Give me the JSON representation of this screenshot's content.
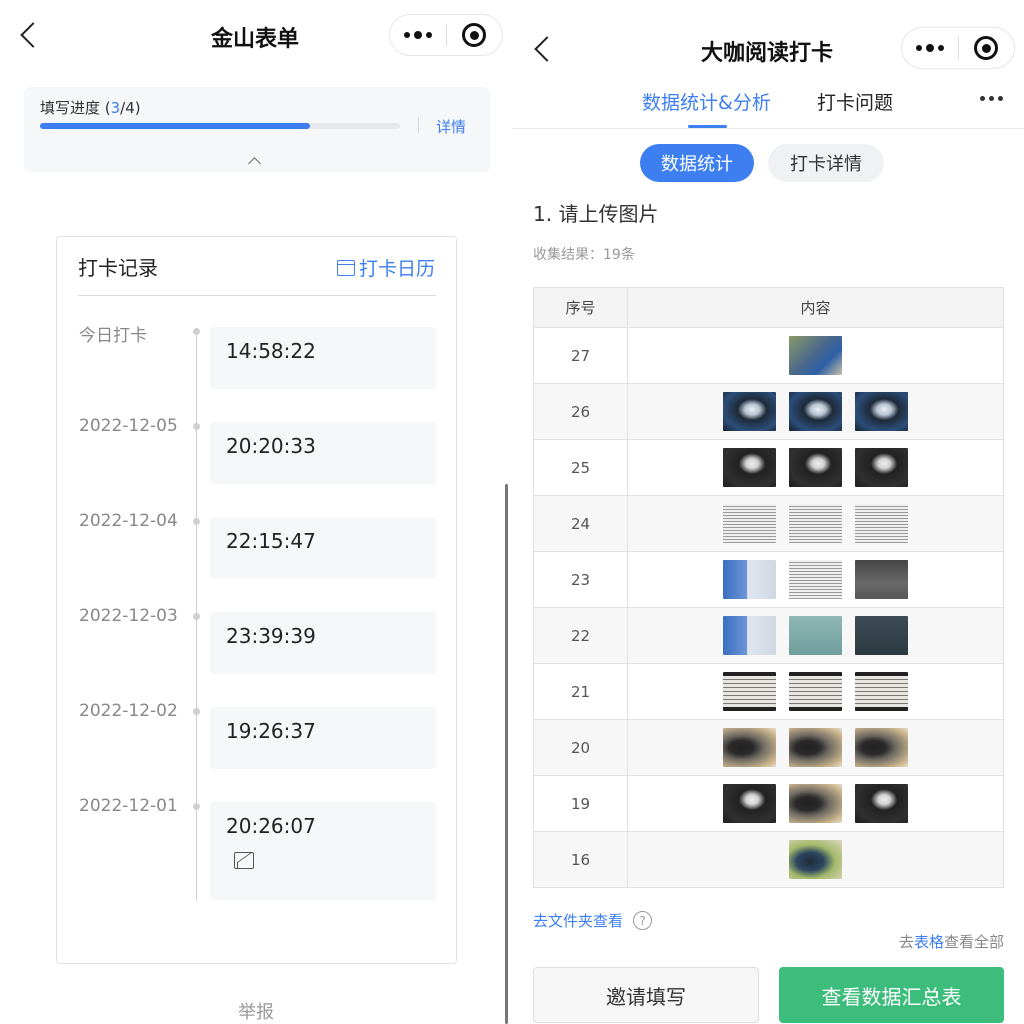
{
  "left": {
    "title": "金山表单",
    "progress": {
      "label_prefix": "填写进度 (",
      "current": "3",
      "label_suffix": "/4)",
      "fraction": 0.75,
      "detail_link": "详情"
    },
    "record": {
      "title": "打卡记录",
      "calendar_link": "打卡日历",
      "entries": [
        {
          "date": "今日打卡",
          "time": "14:58:22",
          "has_image": false
        },
        {
          "date": "2022-12-05",
          "time": "20:20:33",
          "has_image": false
        },
        {
          "date": "2022-12-04",
          "time": "22:15:47",
          "has_image": false
        },
        {
          "date": "2022-12-03",
          "time": "23:39:39",
          "has_image": false
        },
        {
          "date": "2022-12-02",
          "time": "19:26:37",
          "has_image": false
        },
        {
          "date": "2022-12-01",
          "time": "20:26:07",
          "has_image": true
        }
      ]
    },
    "report": "举报"
  },
  "right": {
    "title": "大咖阅读打卡",
    "tabs": [
      {
        "label": "数据统计&分析",
        "active": true
      },
      {
        "label": "打卡问题",
        "active": false
      }
    ],
    "pills": [
      {
        "label": "数据统计",
        "active": true
      },
      {
        "label": "打卡详情",
        "active": false
      }
    ],
    "question": "1. 请上传图片",
    "result_count": "收集结果：19条",
    "table": {
      "headers": [
        "序号",
        "内容"
      ],
      "rows": [
        {
          "num": "27",
          "thumbs": [
            "photo"
          ]
        },
        {
          "num": "26",
          "thumbs": [
            "laptop",
            "laptop",
            "laptop"
          ]
        },
        {
          "num": "25",
          "thumbs": [
            "dark",
            "dark",
            "dark"
          ]
        },
        {
          "num": "24",
          "thumbs": [
            "text",
            "text",
            "text"
          ]
        },
        {
          "num": "23",
          "thumbs": [
            "cover",
            "text",
            "grey"
          ]
        },
        {
          "num": "22",
          "thumbs": [
            "cover",
            "teal",
            "slate"
          ]
        },
        {
          "num": "21",
          "thumbs": [
            "screen",
            "screen",
            "screen"
          ]
        },
        {
          "num": "20",
          "thumbs": [
            "room",
            "room",
            "room"
          ]
        },
        {
          "num": "19",
          "thumbs": [
            "dark",
            "room",
            "dark"
          ]
        },
        {
          "num": "16",
          "thumbs": [
            "kid"
          ]
        }
      ]
    },
    "folder_link": "去文件夹查看",
    "help_icon_glyph": "?",
    "view_all": {
      "prefix": "去",
      "link": "表格",
      "suffix": "查看全部"
    },
    "invite_button": "邀请填写",
    "summary_button": "查看数据汇总表"
  },
  "colors": {
    "accent": "#3d7ff0",
    "success": "#3dbd7b"
  }
}
